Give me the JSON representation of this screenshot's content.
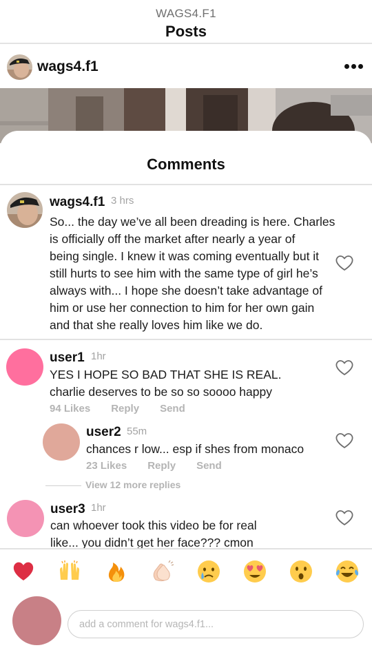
{
  "header": {
    "account": "WAGS4.F1",
    "title": "Posts"
  },
  "post": {
    "username": "wags4.f1",
    "more_icon": "more-horizontal-icon"
  },
  "comments_sheet": {
    "title": "Comments"
  },
  "comments": [
    {
      "username": "wags4.f1",
      "time": "3 hrs",
      "lines": [
        "So... the day we’ve all been dreading is here. Charles",
        "is officially off the market after nearly a year of",
        "being single. I knew it was coming eventually but it",
        "still hurts to see him with the same type of girl he’s",
        "always with... I hope she doesn’t take advantage of",
        "him or use her connection to him for her own gain",
        "and that she really loves him like we do."
      ]
    },
    {
      "username": "user1",
      "time": "1hr",
      "avatar_color": "#ff6f9e",
      "lines": [
        "YES I HOPE SO BAD THAT SHE IS REAL.",
        "charlie deserves to be so so soooo happy"
      ],
      "likes": "94 Likes",
      "reply_label": "Reply",
      "send_label": "Send"
    },
    {
      "username": "user2",
      "time": "55m",
      "avatar_color": "#e0a89a",
      "lines": [
        "chances r low... esp if shes from monaco"
      ],
      "likes": "23 Likes",
      "reply_label": "Reply",
      "send_label": "Send"
    },
    {
      "username": "user3",
      "time": "1hr",
      "avatar_color": "#f493b4",
      "lines": [
        "can whoever took this video be for real",
        "like... you didn’t get her face??? cmon"
      ]
    }
  ],
  "view_more_replies": "View 12 more replies",
  "emoji_bar": [
    {
      "icon": "red-heart-icon",
      "glyph": "❤"
    },
    {
      "icon": "raising-hands-icon",
      "glyph": "🙌"
    },
    {
      "icon": "fire-icon",
      "glyph": "🔥"
    },
    {
      "icon": "clapping-hands-icon",
      "glyph": "👏"
    },
    {
      "icon": "crying-face-icon",
      "glyph": "😢"
    },
    {
      "icon": "heart-eyes-icon",
      "glyph": "😍"
    },
    {
      "icon": "surprised-face-icon",
      "glyph": "😮"
    },
    {
      "icon": "tears-of-joy-icon",
      "glyph": "😂"
    }
  ],
  "composer": {
    "placeholder": "add a comment for wags4.f1...",
    "avatar_color": "#c88086"
  }
}
